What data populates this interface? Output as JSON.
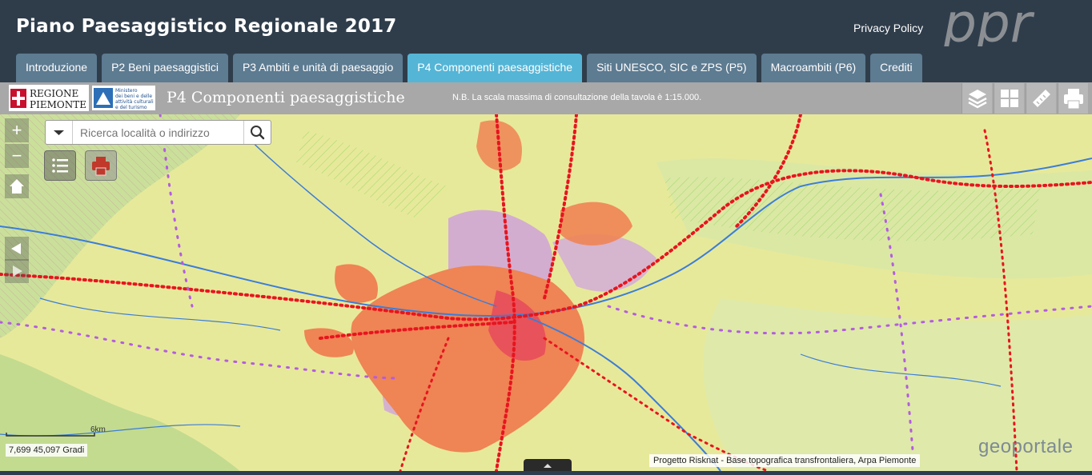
{
  "app": {
    "title": "Piano Paesaggistico Regionale 2017",
    "privacy_label": "Privacy Policy",
    "logo_text": "ppr"
  },
  "tabs": [
    {
      "label": "Introduzione"
    },
    {
      "label": "P2 Beni paesaggistici"
    },
    {
      "label": "P3 Ambiti e unità di paesaggio"
    },
    {
      "label": "P4 Componenti paesaggistiche",
      "active": true
    },
    {
      "label": "Siti UNESCO, SIC e ZPS (P5)"
    },
    {
      "label": "Macroambiti (P6)"
    },
    {
      "label": "Crediti"
    }
  ],
  "subheader": {
    "regione_logo": [
      "REGIONE",
      "PIEMONTE"
    ],
    "ministero_logo": [
      "Ministero",
      "dei beni e delle",
      "attività culturali",
      "e del turismo"
    ],
    "title": "P4 Componenti paesaggistiche",
    "scale_note": "N.B. La scala massima di consultazione della tavola è 1:15.000."
  },
  "toolbar": {
    "icons": [
      "layers-icon",
      "grid-icon",
      "ruler-icon",
      "print-icon"
    ]
  },
  "map_controls": {
    "zoom_in": "+",
    "zoom_out": "−",
    "home_icon": "home-icon"
  },
  "search": {
    "placeholder": "Ricerca località o indirizzo"
  },
  "map": {
    "scale_label": "6km",
    "coordinates": "7,699 45,097 Gradi",
    "attribution": "Progetto Risknat - Base topografica transfrontaliera, Arpa Piemonte",
    "watermark": "geoportale"
  },
  "colors": {
    "header": "#2f3d4b",
    "tab": "#5d7b91",
    "tab_active": "#55b5d6",
    "subbar": "#a8a8a8",
    "urban": "#ef8454",
    "road": "#e8141e",
    "purple": "#b35ce0"
  }
}
